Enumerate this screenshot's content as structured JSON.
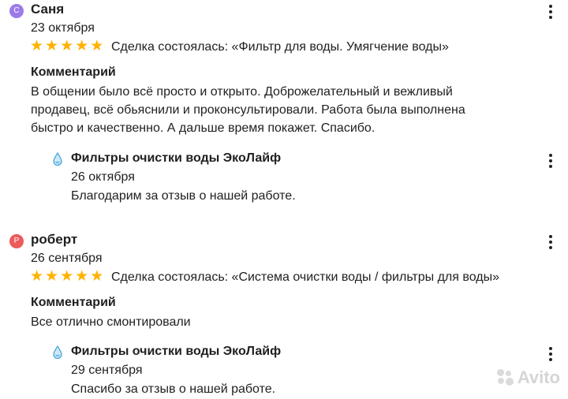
{
  "reviews": [
    {
      "avatar_letter": "С",
      "author": "Саня",
      "date": "23 октября",
      "rating": 5,
      "deal": "Сделка состоялась: «Фильтр для воды. Умягчение воды»",
      "comment_title": "Комментарий",
      "comment_lines": [
        "В общении было всё просто и открыто. Доброжелательный и вежливый",
        "продавец, всё обьяснили и проконсультировали. Работа была выполнена",
        "быстро и качественно. А дальше время покажет. Спасибо."
      ],
      "reply": {
        "author": "Фильтры очистки воды ЭкоЛайф",
        "date": "26 октября",
        "text": "Благодарим за отзыв о нашей работе."
      }
    },
    {
      "avatar_letter": "Р",
      "author": "роберт",
      "date": "26 сентября",
      "rating": 5,
      "deal": "Сделка состоялась: «Система очистки воды / фильтры для воды»",
      "comment_title": "Комментарий",
      "comment_lines": [
        "Все отлично смонтировали"
      ],
      "reply": {
        "author": "Фильтры очистки воды ЭкоЛайф",
        "date": "29 сентября",
        "text": "Спасибо за отзыв о нашей работе."
      }
    }
  ],
  "colors": {
    "star": "#ffb200",
    "avatar_1": "#9c7be8",
    "avatar_2": "#ec5a5a"
  },
  "watermark": "Avito"
}
